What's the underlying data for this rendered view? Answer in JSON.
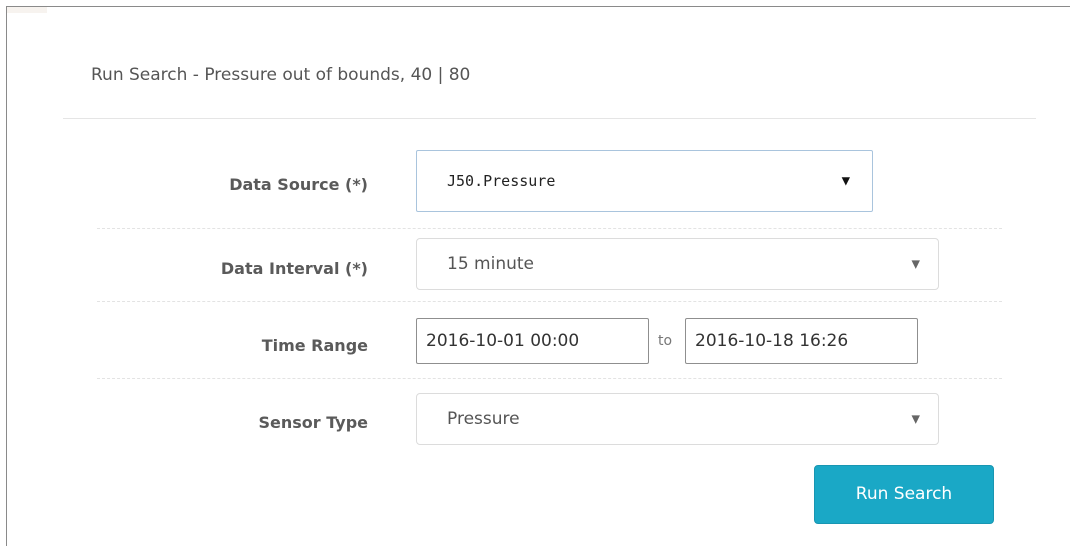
{
  "dialog": {
    "title": "Run Search - Pressure out of bounds, 40 | 80"
  },
  "form": {
    "data_source": {
      "label": "Data Source (*)",
      "value": "J50.Pressure"
    },
    "data_interval": {
      "label": "Data Interval (*)",
      "value": "15 minute"
    },
    "time_range": {
      "label": "Time Range",
      "start": "2016-10-01 00:00",
      "separator": "to",
      "end": "2016-10-18 16:26"
    },
    "sensor_type": {
      "label": "Sensor Type",
      "value": "Pressure"
    }
  },
  "actions": {
    "run_search_label": "Run Search"
  },
  "icons": {
    "native_caret": "caret-down-icon",
    "select_caret": "caret-down-icon"
  },
  "colors": {
    "primary_button": "#1aa8c6",
    "label_text": "#5a5a5a"
  }
}
